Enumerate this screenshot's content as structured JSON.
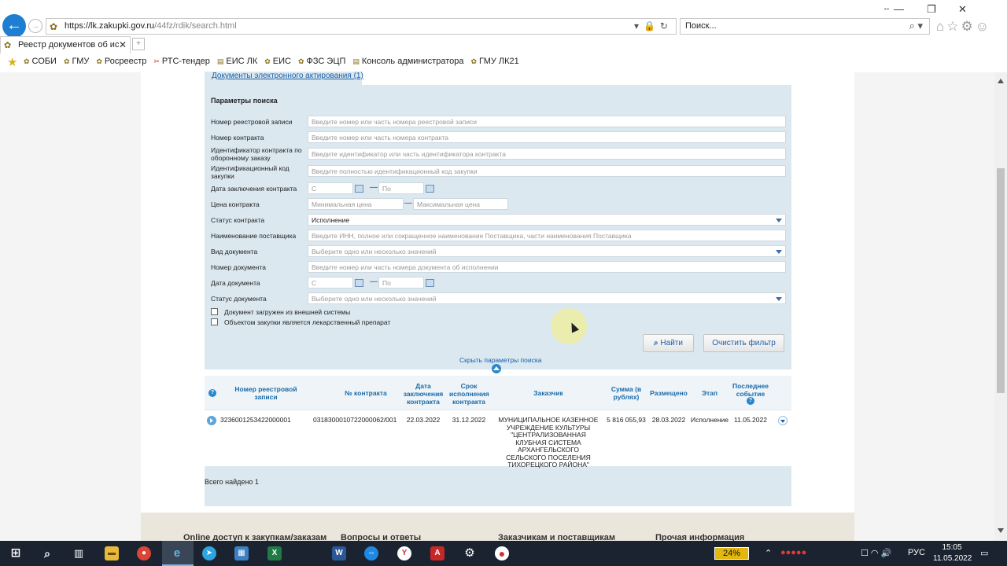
{
  "browser": {
    "url_host": "https://lk.zakupki.gov.ru",
    "url_path": "/44fz/rdik/search.html",
    "search_placeholder": "Поиск...",
    "tab_title": "Реестр документов об исп...",
    "favorites": [
      "СОБИ",
      "ГМУ",
      "Росреестр",
      "РТС-тендер",
      "ЕИС ЛК",
      "ЕИС",
      "ФЗС ЭЦП",
      "Консоль администратора",
      "ГМУ ЛК21"
    ]
  },
  "page": {
    "tab_link": "Документы электронного актирования (1)",
    "search": {
      "title": "Параметры поиска",
      "fields": {
        "registry_number": {
          "label": "Номер реестровой записи",
          "placeholder": "Введите номер или часть номера реестровой записи"
        },
        "contract_number": {
          "label": "Номер контракта",
          "placeholder": "Введите номер или часть номера контракта"
        },
        "defense_id": {
          "label": "Идентификатор контракта по оборонному заказу",
          "placeholder": "Введите идентификатор или часть идентификатора контракта"
        },
        "purchase_code": {
          "label": "Идентификационный код закупки",
          "placeholder": "Введите полностью идентификационный код закупки"
        },
        "conclusion_date": {
          "label": "Дата заключения контракта",
          "from": "С",
          "to": "По"
        },
        "price": {
          "label": "Цена контракта",
          "min": "Минимальная цена",
          "max": "Максимальная цена"
        },
        "contract_status": {
          "label": "Статус контракта",
          "value": "Исполнение"
        },
        "supplier_name": {
          "label": "Наименование поставщика",
          "placeholder": "Введите ИНН, полное или сокращенное наименование Поставщика, части наименования Поставщика"
        },
        "doc_type": {
          "label": "Вид документа",
          "placeholder": "Выберите одно или несколько значений"
        },
        "doc_number": {
          "label": "Номер документа",
          "placeholder": "Введите номер или часть номера документа об исполнении"
        },
        "doc_date": {
          "label": "Дата документа",
          "from": "С",
          "to": "По"
        },
        "doc_status": {
          "label": "Статус документа",
          "placeholder": "Выберите одно или несколько значений"
        }
      },
      "checkboxes": [
        "Документ загружен из внешней системы",
        "Объектом закупки является лекарственный препарат"
      ],
      "find_button": "Найти",
      "clear_button": "Очистить фильтр",
      "hide_link": "Скрыть параметры поиска"
    },
    "results": {
      "headers": [
        "Номер реестровой записи",
        "№ контракта",
        "Дата заключения контракта",
        "Срок исполнения контракта",
        "Заказчик",
        "Сумма (в рублях)",
        "Размещено",
        "Этап",
        "Последнее событие"
      ],
      "rows": [
        {
          "registry": "3236001253422000001",
          "contract": "0318300010722000062/001",
          "date_concluded": "22.03.2022",
          "term": "31.12.2022",
          "customer": "МУНИЦИПАЛЬНОЕ КАЗЕННОЕ УЧРЕЖДЕНИЕ КУЛЬТУРЫ \"ЦЕНТРАЛИЗОВАННАЯ КЛУБНАЯ СИСТЕМА АРХАНГЕЛЬСКОГО СЕЛЬСКОГО ПОСЕЛЕНИЯ ТИХОРЕЦКОГО РАЙОНА\"",
          "sum": "5 816 055,93",
          "posted": "28.03.2022",
          "stage": "Исполнение",
          "last_event": "11.05.2022"
        }
      ],
      "total": "Всего найдено 1"
    },
    "footer_links": [
      "Online доступ к закупкам/заказам",
      "Вопросы и ответы",
      "Заказчикам и поставщикам",
      "Прочая информация"
    ]
  },
  "taskbar": {
    "battery": "24%",
    "lang": "РУС",
    "time": "15:05",
    "date": "11.05.2022"
  }
}
